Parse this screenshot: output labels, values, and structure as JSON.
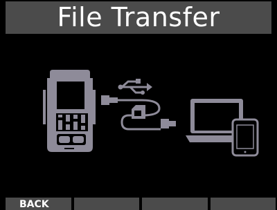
{
  "header": {
    "title": "File Transfer"
  },
  "illustration": {
    "device_icon": "recorder-device-icon",
    "usb_icon": "usb-symbol-icon",
    "cable_icon": "usb-cable-icon",
    "card_icon": "sd-card-icon",
    "laptop_icon": "laptop-icon",
    "phone_icon": "smartphone-icon"
  },
  "softkeys": [
    {
      "label": "BACK"
    },
    {
      "label": ""
    },
    {
      "label": ""
    },
    {
      "label": ""
    }
  ],
  "colors": {
    "bar": "#4b4b4b",
    "icon": "#8e8b99",
    "background": "#000000",
    "text": "#ffffff"
  }
}
